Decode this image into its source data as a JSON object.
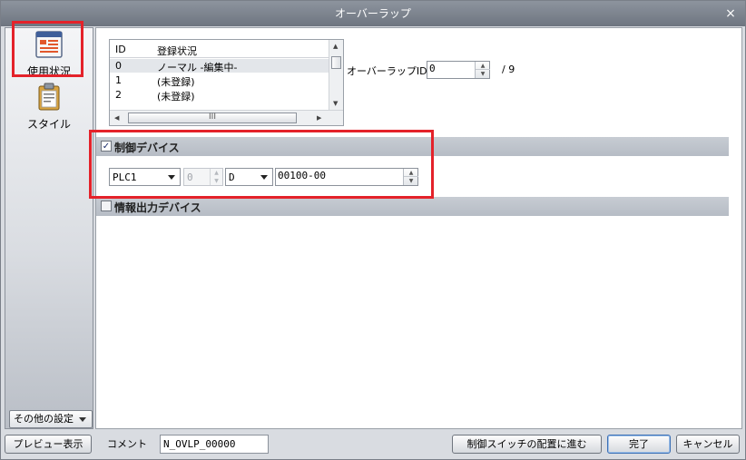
{
  "window": {
    "title": "オーバーラップ",
    "close_glyph": "×"
  },
  "sidebar": {
    "items": [
      {
        "label": "使用状況",
        "icon": "usage-status-icon"
      },
      {
        "label": "スタイル",
        "icon": "style-clipboard-icon"
      }
    ],
    "other_settings_label": "その他の設定"
  },
  "overlap_list": {
    "columns": [
      "ID",
      "登録状況"
    ],
    "rows": [
      {
        "id": "0",
        "status": "ノーマル -編集中-"
      },
      {
        "id": "1",
        "status": "(未登録)"
      },
      {
        "id": "2",
        "status": "(未登録)"
      }
    ],
    "hscroll_grip": "III"
  },
  "overlap_id": {
    "label": "オーバーラップID",
    "value": "0",
    "total": "/ 9"
  },
  "control_device": {
    "title": "制御デバイス",
    "checked": true,
    "check_glyph": "✓",
    "plc": "PLC1",
    "station": "0",
    "device_type": "D",
    "address": "00100-00"
  },
  "info_output_device": {
    "title": "情報出力デバイス",
    "checked": false
  },
  "bottom": {
    "preview_label": "プレビュー表示",
    "comment_label": "コメント",
    "comment_value": "N_OVLP_00000",
    "switch_placement_label": "制御スイッチの配置に進む",
    "done_label": "完了",
    "cancel_label": "キャンセル"
  },
  "colors": {
    "highlight_red": "#e4222a",
    "section_bar": "#bcc2ca"
  }
}
